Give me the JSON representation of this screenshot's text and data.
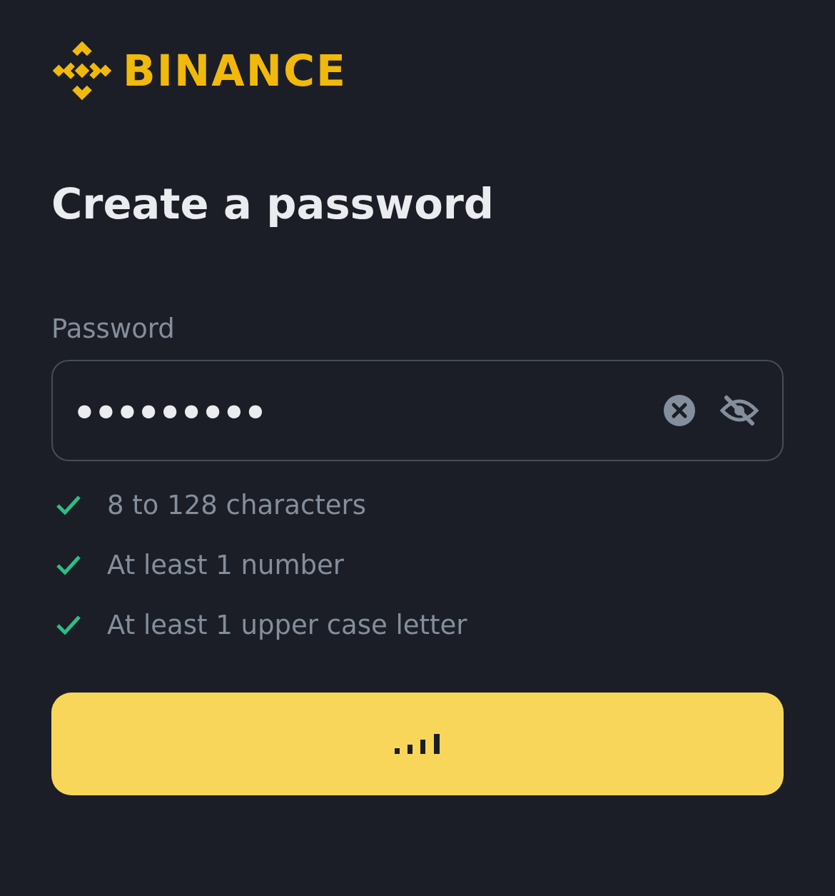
{
  "brand": {
    "name": "BINANCE"
  },
  "title": "Create a password",
  "password_field": {
    "label": "Password",
    "value": "●●●●●●●●●",
    "masked": true
  },
  "requirements": [
    {
      "text": "8 to 128 characters",
      "checked": true
    },
    {
      "text": "At least 1 number",
      "checked": true
    },
    {
      "text": "At least 1 upper case letter",
      "checked": true
    }
  ],
  "submit_button": {
    "loading": true
  }
}
